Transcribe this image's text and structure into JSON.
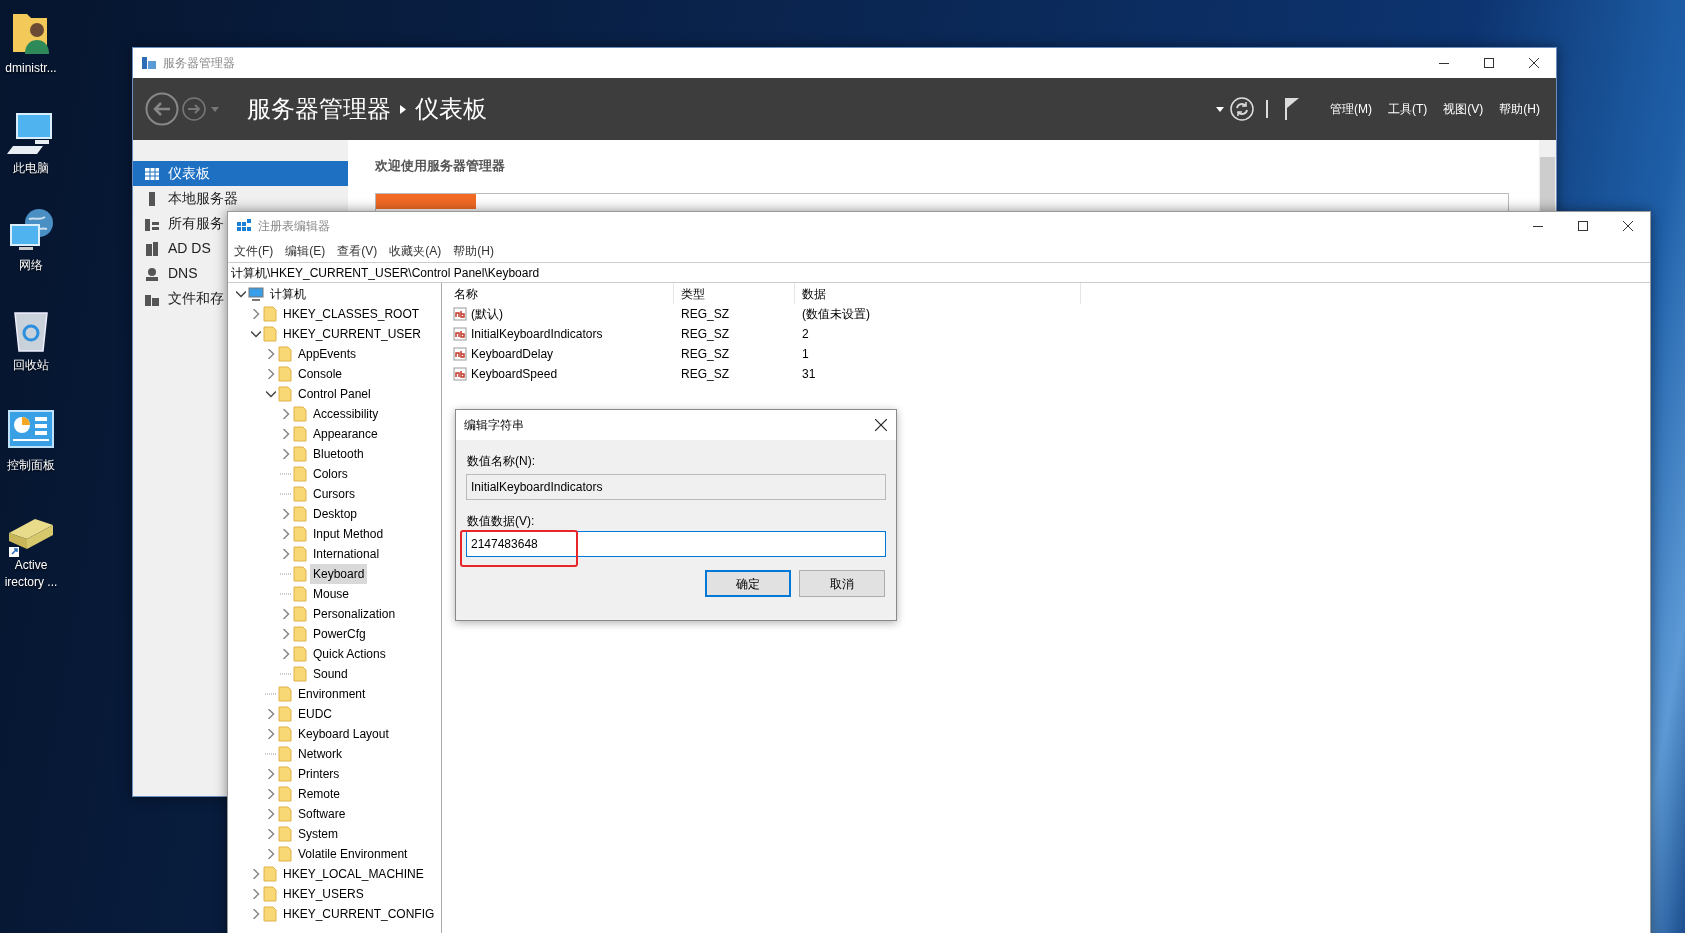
{
  "desktop_icons": [
    {
      "kind": "user-folder",
      "label": "dministr..."
    },
    {
      "kind": "computer",
      "label": "此电脑"
    },
    {
      "kind": "network",
      "label": "网络"
    },
    {
      "kind": "recycle-bin",
      "label": "回收站"
    },
    {
      "kind": "control-panel",
      "label": "控制面板"
    },
    {
      "kind": "shortcut",
      "label": "Active irectory ..."
    }
  ],
  "server_manager": {
    "title": "服务器管理器",
    "breadcrumb": [
      "服务器管理器",
      "仪表板"
    ],
    "menus": [
      "管理(M)",
      "工具(T)",
      "视图(V)",
      "帮助(H)"
    ],
    "nav": [
      {
        "kind": "dashboard",
        "label": "仪表板",
        "selected": true
      },
      {
        "kind": "server",
        "label": "本地服务器",
        "selected": false
      },
      {
        "kind": "servers",
        "label": "所有服务",
        "selected": false
      },
      {
        "kind": "adds",
        "label": "AD DS",
        "selected": false
      },
      {
        "kind": "dns",
        "label": "DNS",
        "selected": false
      },
      {
        "kind": "files",
        "label": "文件和存",
        "selected": false
      }
    ],
    "welcome": "欢迎使用服务器管理器"
  },
  "regedit": {
    "title": "注册表编辑器",
    "menus": [
      "文件(F)",
      "编辑(E)",
      "查看(V)",
      "收藏夹(A)",
      "帮助(H)"
    ],
    "address": "计算机\\HKEY_CURRENT_USER\\Control Panel\\Keyboard",
    "tree": {
      "label": "计算机",
      "expandable": true,
      "expanded": true,
      "selected": false,
      "children": [
        {
          "label": "HKEY_CLASSES_ROOT",
          "expandable": true,
          "expanded": false,
          "selected": false
        },
        {
          "label": "HKEY_CURRENT_USER",
          "expandable": true,
          "expanded": true,
          "selected": false,
          "children": [
            {
              "label": "AppEvents",
              "expandable": true,
              "expanded": false,
              "selected": false
            },
            {
              "label": "Console",
              "expandable": true,
              "expanded": false,
              "selected": false
            },
            {
              "label": "Control Panel",
              "expandable": true,
              "expanded": true,
              "selected": false,
              "children": [
                {
                  "label": "Accessibility",
                  "expandable": true,
                  "expanded": false,
                  "selected": false
                },
                {
                  "label": "Appearance",
                  "expandable": true,
                  "expanded": false,
                  "selected": false
                },
                {
                  "label": "Bluetooth",
                  "expandable": true,
                  "expanded": false,
                  "selected": false
                },
                {
                  "label": "Colors",
                  "expandable": false,
                  "selected": false
                },
                {
                  "label": "Cursors",
                  "expandable": false,
                  "selected": false
                },
                {
                  "label": "Desktop",
                  "expandable": true,
                  "expanded": false,
                  "selected": false
                },
                {
                  "label": "Input Method",
                  "expandable": true,
                  "expanded": false,
                  "selected": false
                },
                {
                  "label": "International",
                  "expandable": true,
                  "expanded": false,
                  "selected": false
                },
                {
                  "label": "Keyboard",
                  "expandable": false,
                  "selected": true
                },
                {
                  "label": "Mouse",
                  "expandable": false,
                  "selected": false
                },
                {
                  "label": "Personalization",
                  "expandable": true,
                  "expanded": false,
                  "selected": false
                },
                {
                  "label": "PowerCfg",
                  "expandable": true,
                  "expanded": false,
                  "selected": false
                },
                {
                  "label": "Quick Actions",
                  "expandable": true,
                  "expanded": false,
                  "selected": false
                },
                {
                  "label": "Sound",
                  "expandable": false,
                  "selected": false
                }
              ]
            },
            {
              "label": "Environment",
              "expandable": false,
              "selected": false
            },
            {
              "label": "EUDC",
              "expandable": true,
              "expanded": false,
              "selected": false
            },
            {
              "label": "Keyboard Layout",
              "expandable": true,
              "expanded": false,
              "selected": false
            },
            {
              "label": "Network",
              "expandable": false,
              "selected": false
            },
            {
              "label": "Printers",
              "expandable": true,
              "expanded": false,
              "selected": false
            },
            {
              "label": "Remote",
              "expandable": true,
              "expanded": false,
              "selected": false
            },
            {
              "label": "Software",
              "expandable": true,
              "expanded": false,
              "selected": false
            },
            {
              "label": "System",
              "expandable": true,
              "expanded": false,
              "selected": false
            },
            {
              "label": "Volatile Environment",
              "expandable": true,
              "expanded": false,
              "selected": false
            }
          ]
        },
        {
          "label": "HKEY_LOCAL_MACHINE",
          "expandable": true,
          "expanded": false,
          "selected": false
        },
        {
          "label": "HKEY_USERS",
          "expandable": true,
          "expanded": false,
          "selected": false
        },
        {
          "label": "HKEY_CURRENT_CONFIG",
          "expandable": true,
          "expanded": false,
          "selected": false
        }
      ]
    },
    "columns": [
      "名称",
      "类型",
      "数据"
    ],
    "rows": [
      {
        "name": "(默认)",
        "type": "REG_SZ",
        "data": "(数值未设置)"
      },
      {
        "name": "InitialKeyboardIndicators",
        "type": "REG_SZ",
        "data": "2"
      },
      {
        "name": "KeyboardDelay",
        "type": "REG_SZ",
        "data": "1"
      },
      {
        "name": "KeyboardSpeed",
        "type": "REG_SZ",
        "data": "31"
      }
    ],
    "dialog": {
      "title": "编辑字符串",
      "name_label": "数值名称(N):",
      "name_value": "InitialKeyboardIndicators",
      "data_label": "数值数据(V):",
      "data_value": "2147483648",
      "data_highlighted": true,
      "buttons": [
        {
          "label": "确定",
          "default": true
        },
        {
          "label": "取消",
          "default": false
        }
      ]
    }
  }
}
